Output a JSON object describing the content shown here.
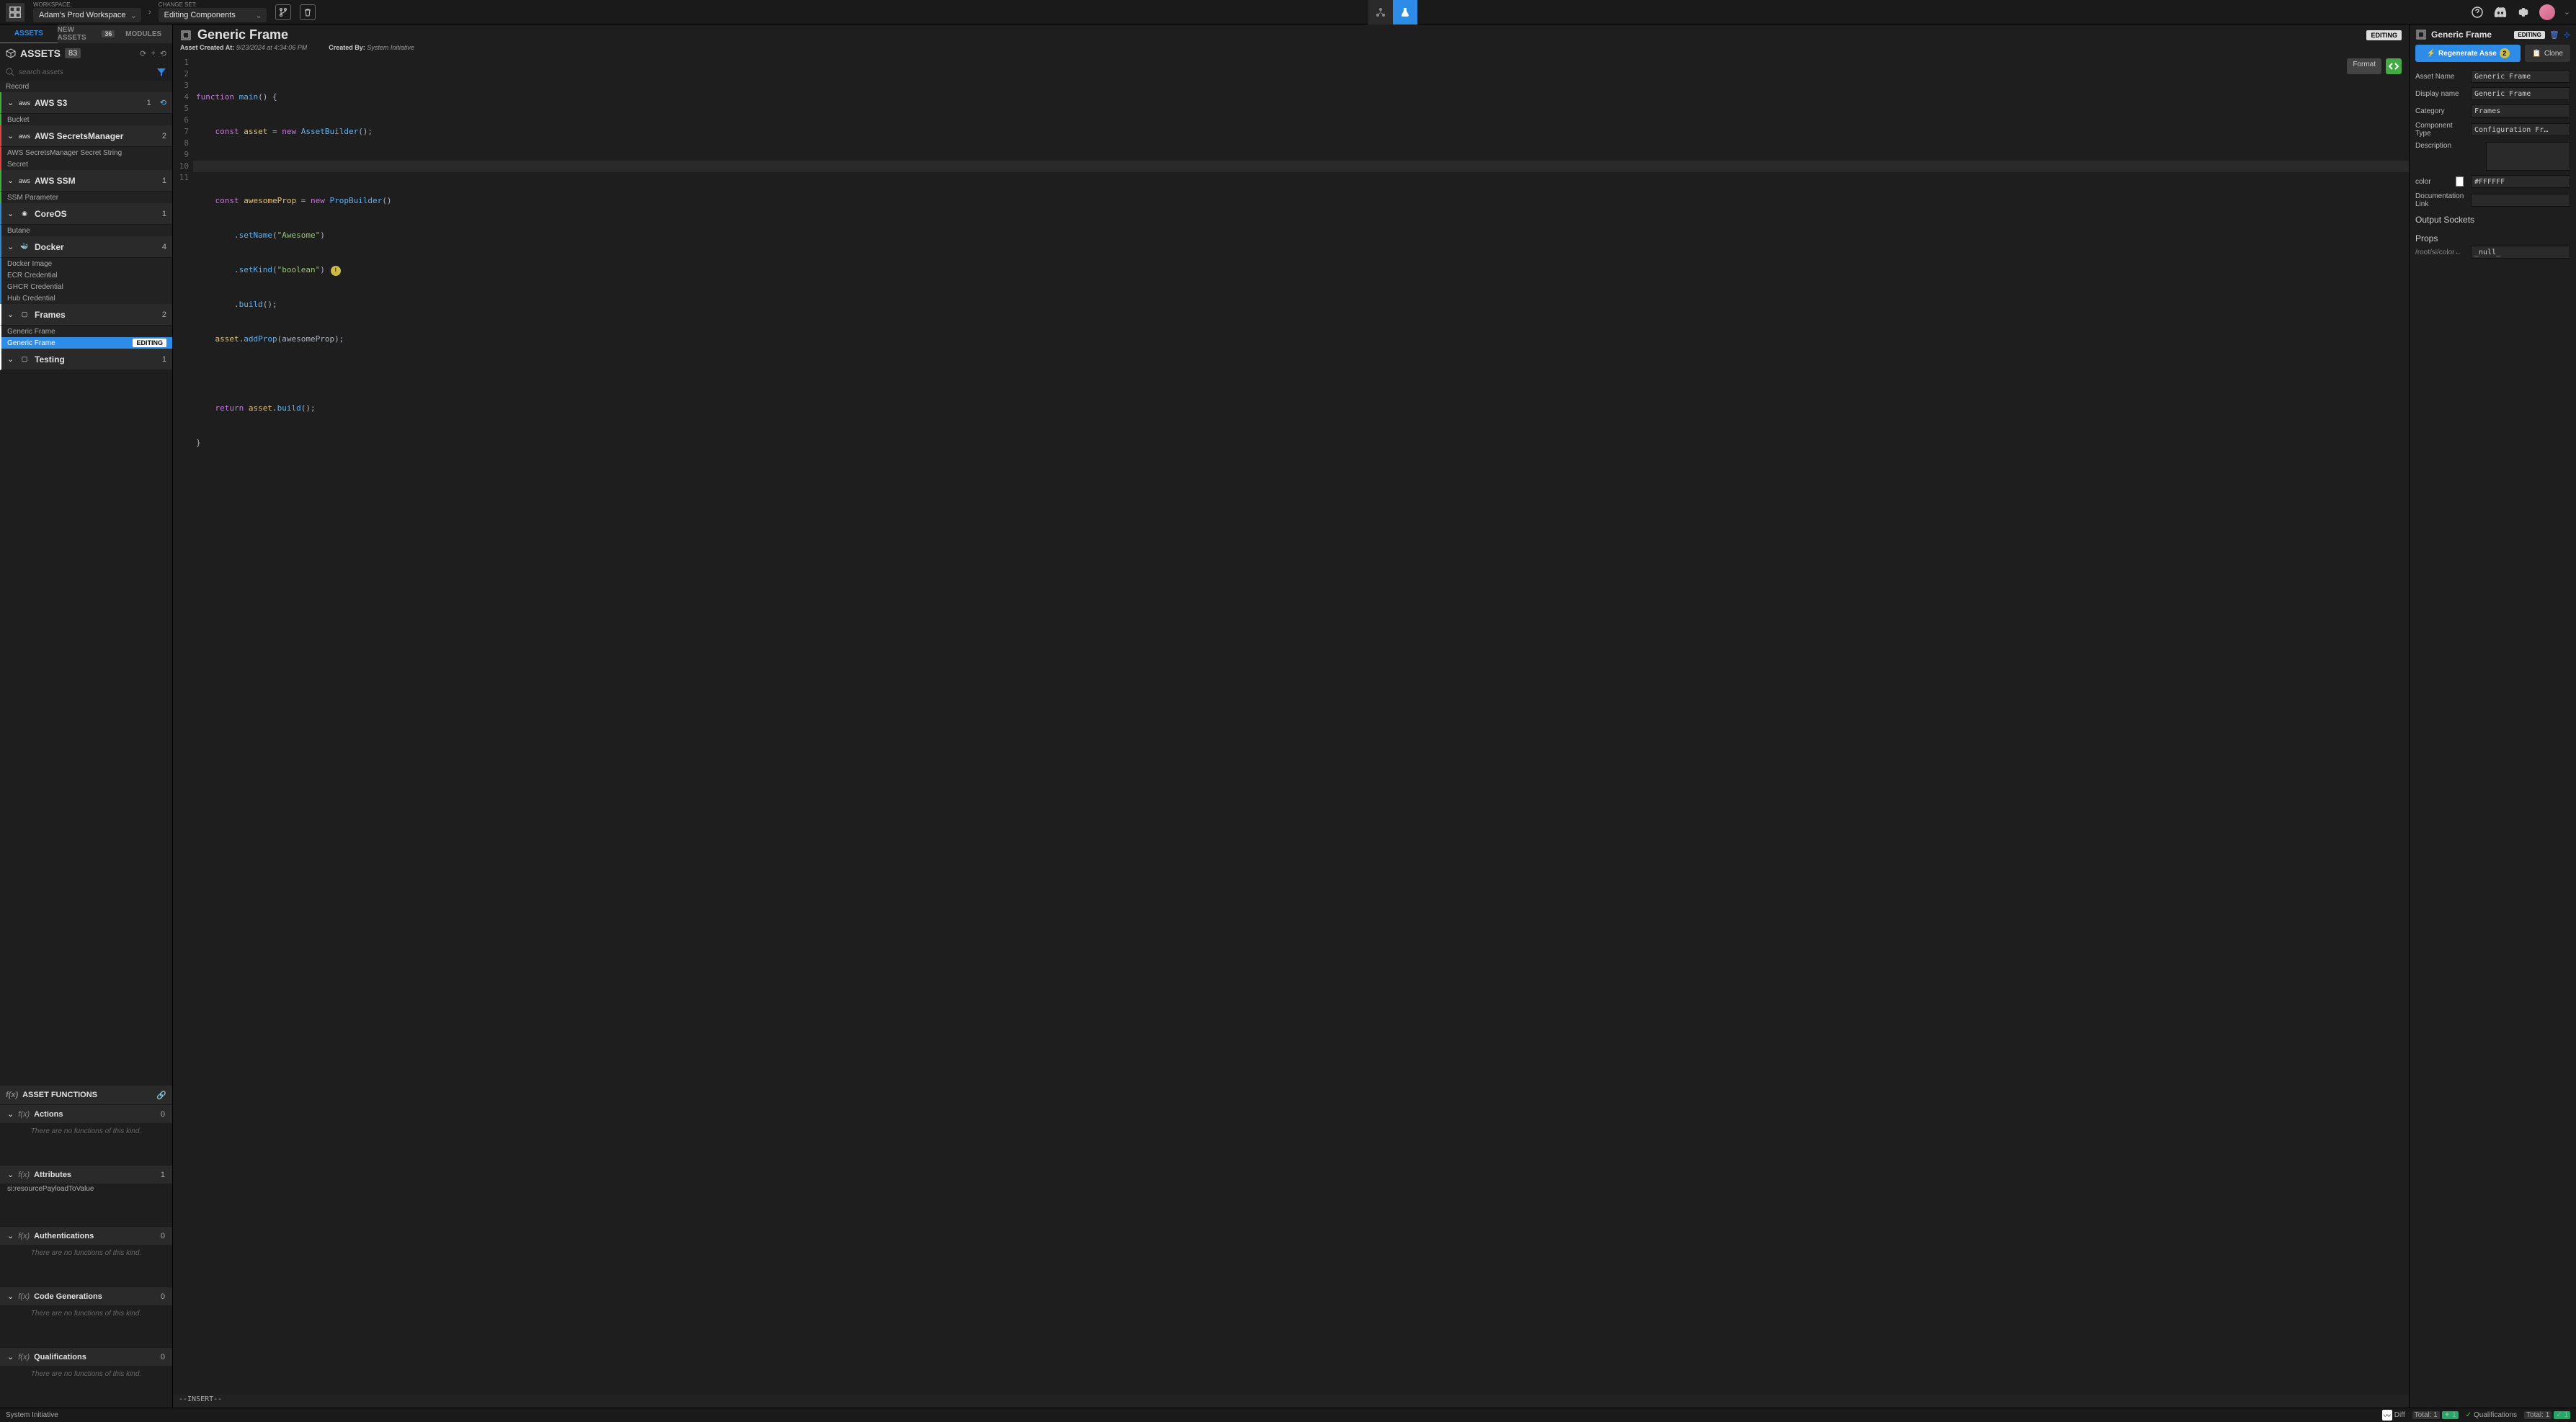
{
  "topbar": {
    "workspace_label": "WORKSPACE:",
    "workspace_value": "Adam's Prod Workspace",
    "changeset_label": "CHANGE SET:",
    "changeset_value": "Editing Components"
  },
  "tabs": {
    "assets": "ASSETS",
    "new_assets": "NEW ASSETS",
    "new_assets_count": "36",
    "modules": "MODULES"
  },
  "assets_header": {
    "title": "ASSETS",
    "count": "83"
  },
  "search": {
    "placeholder": "search assets"
  },
  "tree": {
    "record": "Record",
    "groups": [
      {
        "name": "AWS S3",
        "count": "1",
        "icon": "aws",
        "items": [
          "Bucket"
        ],
        "bl": "bl-green"
      },
      {
        "name": "AWS SecretsManager",
        "count": "2",
        "icon": "aws",
        "items": [
          "AWS SecretsManager Secret String",
          "Secret"
        ],
        "bl": "bl-red"
      },
      {
        "name": "AWS SSM",
        "count": "1",
        "icon": "aws",
        "items": [
          "SSM Parameter"
        ],
        "bl": "bl-green"
      },
      {
        "name": "CoreOS",
        "count": "1",
        "icon": "coreos",
        "items": [
          "Butane"
        ],
        "bl": "bl-blue"
      },
      {
        "name": "Docker",
        "count": "4",
        "icon": "docker",
        "items": [
          "Docker Image",
          "ECR Credential",
          "GHCR Credential",
          "Hub Credential"
        ],
        "bl": "bl-blue"
      },
      {
        "name": "Frames",
        "count": "2",
        "icon": "frames",
        "items": [
          "Generic Frame",
          "Generic Frame"
        ],
        "bl": "bl-white",
        "selected_idx": 1
      },
      {
        "name": "Testing",
        "count": "1",
        "icon": "frames",
        "items": [],
        "bl": "bl-white"
      }
    ],
    "editing_pill": "EDITING"
  },
  "funcs": {
    "header": "ASSET FUNCTIONS",
    "sections": [
      {
        "name": "Actions",
        "count": "0",
        "empty": "There are no functions of this kind."
      },
      {
        "name": "Attributes",
        "count": "1",
        "items": [
          "si:resourcePayloadToValue"
        ]
      },
      {
        "name": "Authentications",
        "count": "0",
        "empty": "There are no functions of this kind."
      },
      {
        "name": "Code Generations",
        "count": "0",
        "empty": "There are no functions of this kind."
      },
      {
        "name": "Qualifications",
        "count": "0",
        "empty": "There are no functions of this kind."
      }
    ]
  },
  "editor": {
    "title": "Generic Frame",
    "editing_pill": "EDITING",
    "created_label": "Asset Created At:",
    "created_value": "9/23/2024 at 4:34:06 PM",
    "createdby_label": "Created By:",
    "createdby_value": "System Initiative",
    "format_btn": "Format",
    "lines": [
      "1",
      "2",
      "3",
      "4",
      "5",
      "6",
      "7",
      "8",
      "9",
      "10",
      "11"
    ],
    "status": "--INSERT--",
    "code": {
      "l1a": "function",
      "l1b": " main",
      "l1c": "() {",
      "l2a": "    const",
      "l2b": " asset ",
      "l2c": "=",
      "l2d": " new",
      "l2e": " AssetBuilder",
      "l2f": "();",
      "l4a": "    const",
      "l4b": " awesomeProp ",
      "l4c": "=",
      "l4d": " new",
      "l4e": " PropBuilder",
      "l4f": "()",
      "l5a": "        .",
      "l5b": "setName",
      "l5c": "(",
      "l5d": "\"Awesome\"",
      "l5e": ")",
      "l6a": "        .",
      "l6b": "setKind",
      "l6c": "(",
      "l6d": "\"boolean\"",
      "l6e": ")",
      "l7a": "        .",
      "l7b": "build",
      "l7c": "();",
      "l8a": "    asset.",
      "l8b": "addProp",
      "l8c": "(awesomeProp);",
      "l10a": "    return",
      "l10b": " asset.",
      "l10c": "build",
      "l10d": "();",
      "l11a": "}"
    }
  },
  "right": {
    "title": "Generic Frame",
    "editing_pill": "EDITING",
    "regen": "Regenerate Asse",
    "regen_warn": "2",
    "clone": "Clone",
    "props": {
      "asset_name_l": "Asset Name",
      "asset_name_v": "Generic Frame",
      "display_l": "Display name",
      "display_v": "Generic Frame",
      "category_l": "Category",
      "category_v": "Frames",
      "comptype_l": "Component Type",
      "comptype_v": "Configuration Fr…",
      "desc_l": "Description",
      "color_l": "color",
      "color_v": "#FFFFFF",
      "doc_l": "Documentation Link"
    },
    "output_sockets": "Output Sockets",
    "props_h": "Props",
    "props_path": "/root/si/color←",
    "null_v": "_null_"
  },
  "statusbar": {
    "left": "System Initiative",
    "diff": "Diff",
    "total1_l": "Total:",
    "total1_v": "1",
    "green1": "1",
    "qual": "Qualifications",
    "total2_l": "Total:",
    "total2_v": "1",
    "green2": "1"
  }
}
